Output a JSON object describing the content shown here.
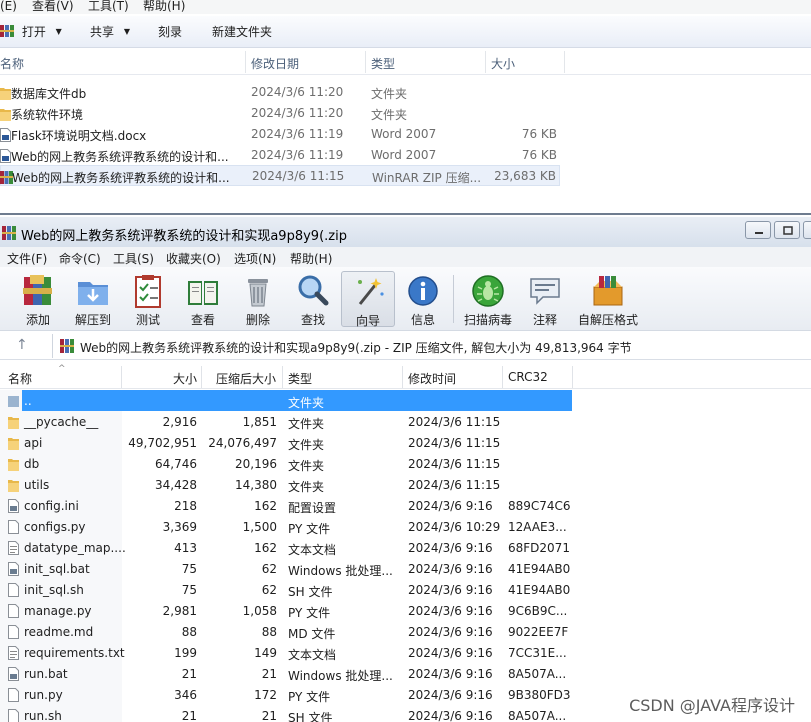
{
  "explorer": {
    "menu": [
      "(E)",
      "查看(V)",
      "工具(T)",
      "帮助(H)"
    ],
    "toolbar": {
      "open": "打开",
      "share": "共享",
      "burn": "刻录",
      "new_folder": "新建文件夹"
    },
    "columns": {
      "name": "名称",
      "date": "修改日期",
      "type": "类型",
      "size": "大小"
    },
    "rows": [
      {
        "name": "数据库文件db",
        "date": "2024/3/6 11:20",
        "type": "文件夹",
        "size": "",
        "icon": "folder-icon"
      },
      {
        "name": "系统软件环境",
        "date": "2024/3/6 11:20",
        "type": "文件夹",
        "size": "",
        "icon": "folder-icon"
      },
      {
        "name": "Flask环境说明文档.docx",
        "date": "2024/3/6 11:19",
        "type": "Word 2007",
        "size": "76 KB",
        "icon": "word-doc-icon"
      },
      {
        "name": "Web的网上教务系统评教系统的设计和...",
        "date": "2024/3/6 11:19",
        "type": "Word 2007",
        "size": "76 KB",
        "icon": "word-doc-icon"
      },
      {
        "name": "Web的网上教务系统评教系统的设计和...",
        "date": "2024/3/6 11:15",
        "type": "WinRAR ZIP 压缩...",
        "size": "23,683 KB",
        "icon": "winrar-zip-icon"
      }
    ]
  },
  "winrar": {
    "title": "Web的网上教务系统评教系统的设计和实现a9p8y9(.zip",
    "menu": [
      "文件(F)",
      "命令(C)",
      "工具(S)",
      "收藏夹(O)",
      "选项(N)",
      "帮助(H)"
    ],
    "tools": [
      {
        "label": "添加",
        "icon": "add-archive-icon"
      },
      {
        "label": "解压到",
        "icon": "extract-to-icon"
      },
      {
        "label": "测试",
        "icon": "test-icon"
      },
      {
        "label": "查看",
        "icon": "view-icon"
      },
      {
        "label": "删除",
        "icon": "delete-icon"
      },
      {
        "label": "查找",
        "icon": "find-icon"
      },
      {
        "label": "向导",
        "icon": "wizard-icon"
      },
      {
        "label": "信息",
        "icon": "info-icon"
      },
      {
        "label": "扫描病毒",
        "icon": "virus-scan-icon"
      },
      {
        "label": "注释",
        "icon": "comment-icon"
      },
      {
        "label": "自解压格式",
        "icon": "sfx-icon"
      }
    ],
    "path": "Web的网上教务系统评教系统的设计和实现a9p8y9(.zip - ZIP 压缩文件, 解包大小为 49,813,964 字节",
    "columns": {
      "name": "名称",
      "size": "大小",
      "packed": "压缩后大小",
      "type": "类型",
      "modified": "修改时间",
      "crc": "CRC32"
    },
    "rows": [
      {
        "name": "..",
        "size": "",
        "packed": "",
        "type": "文件夹",
        "modified": "",
        "crc": "",
        "icon": "parent-folder-icon",
        "selected": true
      },
      {
        "name": "__pycache__",
        "size": "2,916",
        "packed": "1,851",
        "type": "文件夹",
        "modified": "2024/3/6 11:15",
        "crc": "",
        "icon": "folder-icon"
      },
      {
        "name": "api",
        "size": "49,702,951",
        "packed": "24,076,497",
        "type": "文件夹",
        "modified": "2024/3/6 11:15",
        "crc": "",
        "icon": "folder-icon"
      },
      {
        "name": "db",
        "size": "64,746",
        "packed": "20,196",
        "type": "文件夹",
        "modified": "2024/3/6 11:15",
        "crc": "",
        "icon": "folder-icon"
      },
      {
        "name": "utils",
        "size": "34,428",
        "packed": "14,380",
        "type": "文件夹",
        "modified": "2024/3/6 11:15",
        "crc": "",
        "icon": "folder-icon"
      },
      {
        "name": "config.ini",
        "size": "218",
        "packed": "162",
        "type": "配置设置",
        "modified": "2024/3/6 9:16",
        "crc": "889C74C6",
        "icon": "settings-file-icon"
      },
      {
        "name": "configs.py",
        "size": "3,369",
        "packed": "1,500",
        "type": "PY 文件",
        "modified": "2024/3/6 10:29",
        "crc": "12AAE3...",
        "icon": "file-icon"
      },
      {
        "name": "datatype_map....",
        "size": "413",
        "packed": "162",
        "type": "文本文档",
        "modified": "2024/3/6 9:16",
        "crc": "68FD2071",
        "icon": "text-file-icon"
      },
      {
        "name": "init_sql.bat",
        "size": "75",
        "packed": "62",
        "type": "Windows 批处理...",
        "modified": "2024/3/6 9:16",
        "crc": "41E94AB0",
        "icon": "batch-file-icon"
      },
      {
        "name": "init_sql.sh",
        "size": "75",
        "packed": "62",
        "type": "SH 文件",
        "modified": "2024/3/6 9:16",
        "crc": "41E94AB0",
        "icon": "file-icon"
      },
      {
        "name": "manage.py",
        "size": "2,981",
        "packed": "1,058",
        "type": "PY 文件",
        "modified": "2024/3/6 9:16",
        "crc": "9C6B9C...",
        "icon": "file-icon"
      },
      {
        "name": "readme.md",
        "size": "88",
        "packed": "88",
        "type": "MD 文件",
        "modified": "2024/3/6 9:16",
        "crc": "9022EE7F",
        "icon": "file-icon"
      },
      {
        "name": "requirements.txt",
        "size": "199",
        "packed": "149",
        "type": "文本文档",
        "modified": "2024/3/6 9:16",
        "crc": "7CC31E...",
        "icon": "text-file-icon"
      },
      {
        "name": "run.bat",
        "size": "21",
        "packed": "21",
        "type": "Windows 批处理...",
        "modified": "2024/3/6 9:16",
        "crc": "8A507A...",
        "icon": "batch-file-icon"
      },
      {
        "name": "run.py",
        "size": "346",
        "packed": "172",
        "type": "PY 文件",
        "modified": "2024/3/6 9:16",
        "crc": "9B380FD3",
        "icon": "file-icon"
      },
      {
        "name": "run.sh",
        "size": "21",
        "packed": "21",
        "type": "SH 文件",
        "modified": "2024/3/6 9:16",
        "crc": "8A507A...",
        "icon": "file-icon"
      }
    ]
  },
  "watermark": "CSDN @JAVA程序设计"
}
